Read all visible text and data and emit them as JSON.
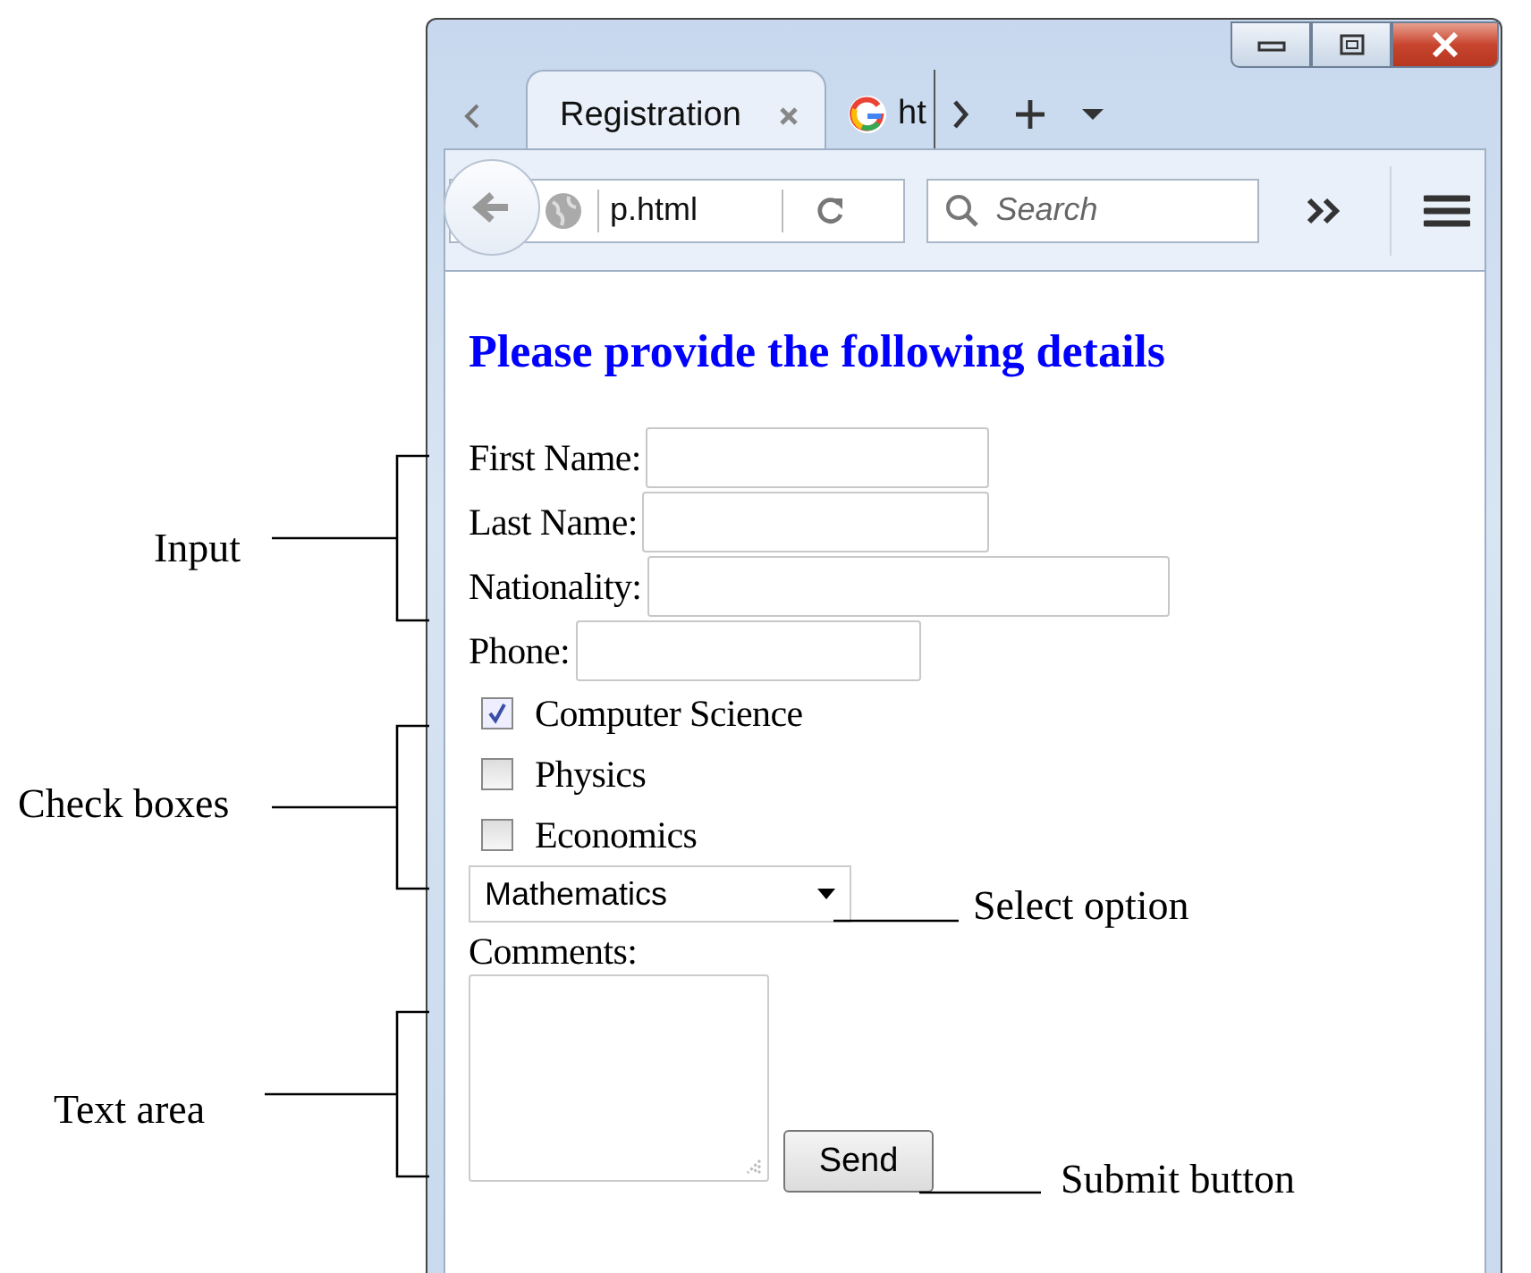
{
  "tabs": [
    {
      "label": "Registration",
      "kind": "page",
      "selected": true
    },
    {
      "label": "ht",
      "kind": "google",
      "selected": false
    }
  ],
  "address_bar": {
    "value": "p.html"
  },
  "search": {
    "placeholder": "Search"
  },
  "page": {
    "heading": "Please provide the following details",
    "fields": [
      {
        "label": "First Name:"
      },
      {
        "label": "Last Name:"
      },
      {
        "label": "Nationality:"
      },
      {
        "label": "Phone:"
      }
    ],
    "checkboxes": [
      {
        "label": "Computer Science",
        "checked": true
      },
      {
        "label": "Physics",
        "checked": false
      },
      {
        "label": "Economics",
        "checked": false
      }
    ],
    "select": {
      "value": "Mathematics"
    },
    "comments_label": "Comments:",
    "submit": "Send"
  },
  "annotations": [
    {
      "label": "Input"
    },
    {
      "label": "Check boxes"
    },
    {
      "label": "Select option"
    },
    {
      "label": "Text area"
    },
    {
      "label": "Submit button"
    }
  ]
}
